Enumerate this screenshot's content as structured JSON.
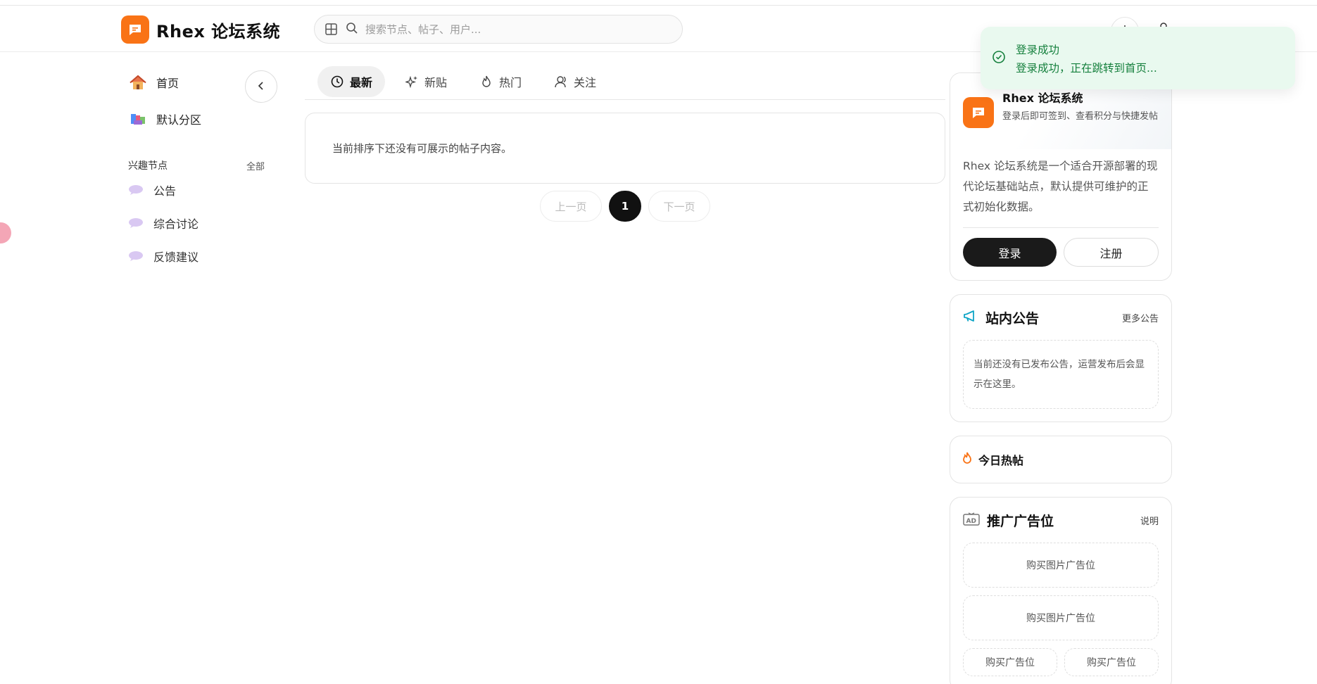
{
  "app": {
    "name": "Rhex 论坛系统"
  },
  "search": {
    "placeholder": "搜索节点、帖子、用户..."
  },
  "sidebar": {
    "home": "首页",
    "default_zone": "默认分区",
    "section_title": "兴趣节点",
    "section_all": "全部",
    "nodes": [
      {
        "label": "公告"
      },
      {
        "label": "综合讨论"
      },
      {
        "label": "反馈建议"
      }
    ]
  },
  "tabs": [
    {
      "label": "最新",
      "active": true,
      "icon": "clock-icon"
    },
    {
      "label": "新贴",
      "active": false,
      "icon": "sparkle-icon"
    },
    {
      "label": "热门",
      "active": false,
      "icon": "flame-icon"
    },
    {
      "label": "关注",
      "active": false,
      "icon": "user-icon"
    }
  ],
  "feed": {
    "empty_text": "当前排序下还没有可展示的帖子内容。"
  },
  "pager": {
    "prev": "上一页",
    "current": "1",
    "next": "下一页"
  },
  "site_card": {
    "name": "Rhex 论坛系统",
    "subtitle": "登录后即可签到、查看积分与快捷发帖",
    "description": "Rhex 论坛系统是一个适合开源部署的现代论坛基础站点，默认提供可维护的正式初始化数据。",
    "login": "登录",
    "register": "注册"
  },
  "announcements": {
    "title": "站内公告",
    "more": "更多公告",
    "empty": "当前还没有已发布公告，运营发布后会显示在这里。"
  },
  "hot_today": {
    "title": "今日热帖"
  },
  "ads": {
    "title": "推广广告位",
    "info": "说明",
    "image_slot_1": "购买图片广告位",
    "image_slot_2": "购买图片广告位",
    "text_slot_1": "购买广告位",
    "text_slot_2": "购买广告位"
  },
  "toast": {
    "title": "登录成功",
    "message": "登录成功，正在跳转到首页..."
  },
  "colors": {
    "brand": "#f97316",
    "toast_bg": "#e9f9ef",
    "toast_text": "#15803d",
    "dark_button": "#1a1a1a"
  }
}
